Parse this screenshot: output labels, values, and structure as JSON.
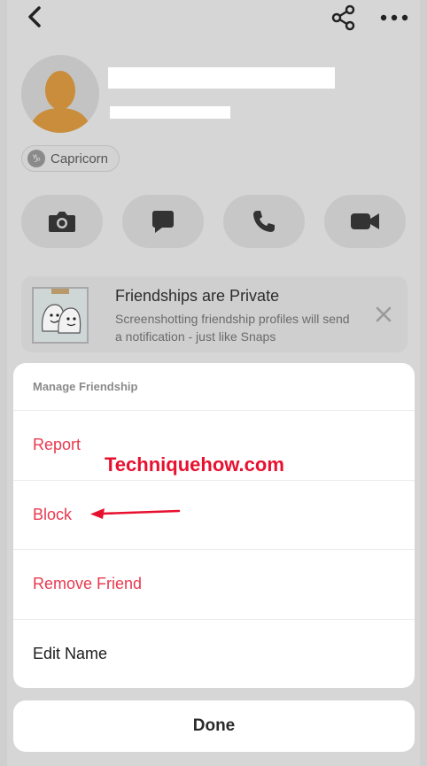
{
  "profile": {
    "zodiac_glyph": "♑",
    "zodiac_label": "Capricorn"
  },
  "notice": {
    "title": "Friendships are Private",
    "body": "Screenshotting friendship profiles will send a notification - just like Snaps"
  },
  "sheet": {
    "header": "Manage Friendship",
    "items": [
      {
        "label": "Report",
        "style": "danger"
      },
      {
        "label": "Block",
        "style": "danger"
      },
      {
        "label": "Remove Friend",
        "style": "danger"
      },
      {
        "label": "Edit Name",
        "style": "normal"
      }
    ]
  },
  "done_label": "Done",
  "watermark": "Techniquehow.com",
  "colors": {
    "danger": "#e8394f",
    "annotation_red": "#e8102f",
    "dim_overlay": "#d6d6d6"
  },
  "icons": [
    "back-arrow-icon",
    "share-icon",
    "more-dots-icon",
    "camera-icon",
    "chat-icon",
    "phone-icon",
    "video-icon",
    "close-icon"
  ]
}
